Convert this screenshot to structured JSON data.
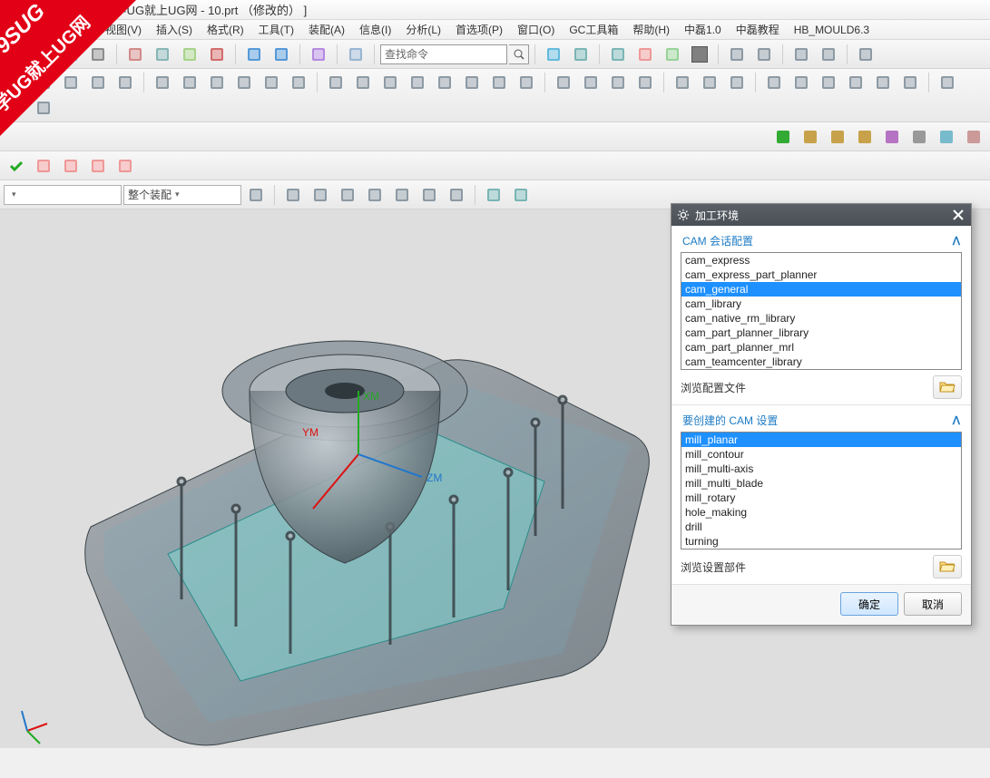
{
  "title": "- [学UG就上UG网 - 10.prt （修改的） ]",
  "watermark": {
    "line1": "9SUG",
    "line2": "学UG就上UG网"
  },
  "menu": [
    "视图(V)",
    "插入(S)",
    "格式(R)",
    "工具(T)",
    "装配(A)",
    "信息(I)",
    "分析(L)",
    "首选项(P)",
    "窗口(O)",
    "GC工具箱",
    "帮助(H)",
    "中磊1.0",
    "中磊教程",
    "HB_MOULD6.3"
  ],
  "searchPlaceholder": "查找命令",
  "comboSel": "整个装配",
  "dialog": {
    "title": "加工环境",
    "section1": "CAM 会话配置",
    "cfg": [
      "cam_express",
      "cam_express_part_planner",
      "cam_general",
      "cam_library",
      "cam_native_rm_library",
      "cam_part_planner_library",
      "cam_part_planner_mrl",
      "cam_teamcenter_library"
    ],
    "cfgSel": 2,
    "browse1": "浏览配置文件",
    "section2": "要创建的 CAM 设置",
    "cam": [
      "mill_planar",
      "mill_contour",
      "mill_multi-axis",
      "mill_multi_blade",
      "mill_rotary",
      "hole_making",
      "drill",
      "turning"
    ],
    "camSel": 0,
    "browse2": "浏览设置部件",
    "ok": "确定",
    "cancel": "取消"
  },
  "axis": {
    "x": "XM",
    "y": "YM",
    "z": "ZM"
  }
}
